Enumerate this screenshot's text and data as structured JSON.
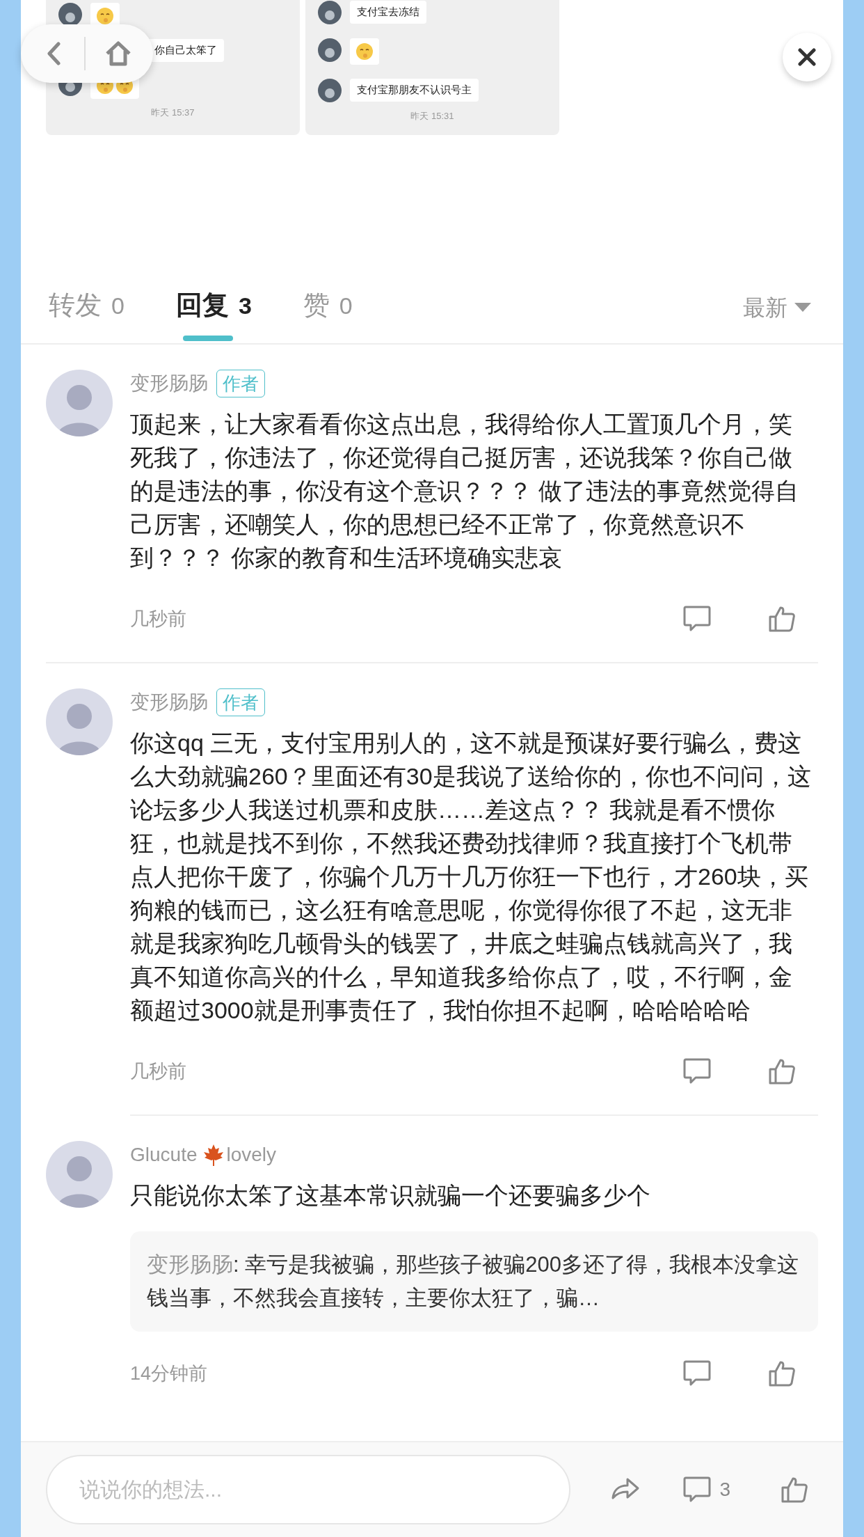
{
  "post_images": [
    {
      "messages": [
        {
          "kind": "emoji"
        },
        {
          "kind": "text",
          "text": "你自己太笨了",
          "partly_covered": true
        },
        {
          "kind": "double_emoji"
        }
      ],
      "time": "昨天 15:37"
    },
    {
      "messages": [
        {
          "kind": "text",
          "text": "支付宝去冻结"
        },
        {
          "kind": "emoji"
        },
        {
          "kind": "text",
          "text": "支付宝那朋友不认识号主"
        }
      ],
      "time": "昨天 15:31"
    }
  ],
  "tabs": [
    {
      "label": "转发",
      "count": "0",
      "selected": false
    },
    {
      "label": "回复",
      "count": "3",
      "selected": true
    },
    {
      "label": "赞",
      "count": "0",
      "selected": false
    }
  ],
  "sort": {
    "label": "最新"
  },
  "comments": [
    {
      "author": "变形肠肠",
      "badge": "作者",
      "text": "顶起来，让大家看看你这点出息，我得给你人工置顶几个月，笑死我了，你违法了，你还觉得自己挺厉害，还说我笨？你自己做的是违法的事，你没有这个意识？？？ 做了违法的事竟然觉得自己厉害，还嘲笑人，你的思想已经不正常了，你竟然意识不到？？？ 你家的教育和生活环境确实悲哀",
      "time": "几秒前"
    },
    {
      "author": "变形肠肠",
      "badge": "作者",
      "text": "你这qq 三无，支付宝用别人的，这不就是预谋好要行骗么，费这么大劲就骗260？里面还有30是我说了送给你的，你也不问问，这论坛多少人我送过机票和皮肤……差这点？？ 我就是看不惯你狂，也就是找不到你，不然我还费劲找律师？我直接打个飞机带点人把你干废了，你骗个几万十几万你狂一下也行，才260块，买狗粮的钱而已，这么狂有啥意思呢，你觉得你很了不起，这无非就是我家狗吃几顿骨头的钱罢了，井底之蛙骗点钱就高兴了，我真不知道你高兴的什么，早知道我多给你点了，哎，不行啊，金额超过3000就是刑事责任了，我怕你担不起啊，哈哈哈哈哈",
      "time": "几秒前"
    },
    {
      "author": "Glucute",
      "author_after_icon": "lovely",
      "text": "只能说你太笨了这基本常识就骗一个还要骗多少个",
      "quote": {
        "author": "变形肠肠",
        "text": ": 幸亏是我被骗，那些孩子被骗200多还了得，我根本没拿这钱当事，不然我会直接转，主要你太狂了，骗…"
      },
      "time": "14分钟前"
    }
  ],
  "footer": {
    "placeholder": "说说你的想法...",
    "comment_count": "3"
  }
}
